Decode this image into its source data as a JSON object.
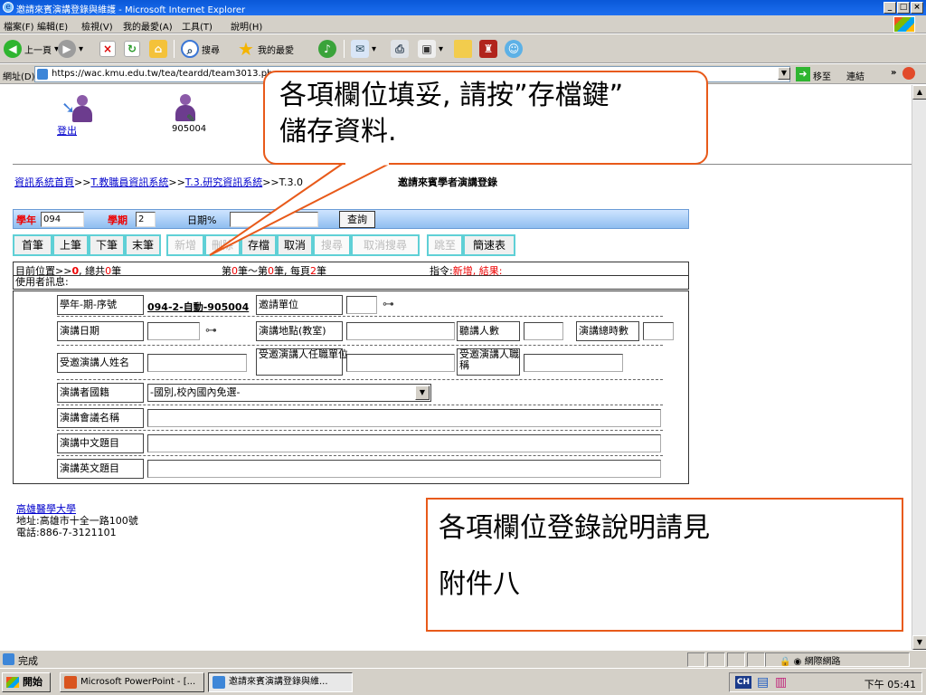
{
  "window": {
    "title": "邀請來賓演講登錄與維護 - Microsoft Internet Explorer",
    "min": "_",
    "max": "□",
    "close": "×"
  },
  "menu": [
    "檔案(F)",
    "編輯(E)",
    "檢視(V)",
    "我的最愛(A)",
    "工具(T)",
    "說明(H)"
  ],
  "toolbar": {
    "back": "上一頁",
    "search": "搜尋",
    "favorites": "我的最愛"
  },
  "address": {
    "label": "網址(D)",
    "url": "https://wac.kmu.edu.tw/tea/teardd/team3013.ph",
    "go": "移至",
    "links": "連結",
    "chevron": "»"
  },
  "header": {
    "logout": "登出",
    "user_id": "905004"
  },
  "breadcrumb": {
    "items": [
      "資訊系統首頁",
      "T.教職員資訊系統",
      "T.3.研究資訊系統"
    ],
    "sep": ">>",
    "tail": ">>T.3.0",
    "title": "邀請來賓學者演講登錄"
  },
  "query": {
    "year_label": "學年",
    "year_value": "094",
    "term_label": "學期",
    "term_value": "2",
    "date_label": "日期%",
    "date_value": "",
    "query_button": "查詢"
  },
  "actions": [
    {
      "label": "首筆",
      "enabled": true
    },
    {
      "label": "上筆",
      "enabled": true
    },
    {
      "label": "下筆",
      "enabled": true
    },
    {
      "label": "末筆",
      "enabled": true
    },
    {
      "label": "新增",
      "enabled": false
    },
    {
      "label": "刪除",
      "enabled": false
    },
    {
      "label": "存檔",
      "enabled": true
    },
    {
      "label": "取消",
      "enabled": true
    },
    {
      "label": "搜尋",
      "enabled": false
    },
    {
      "label": "取消搜尋",
      "enabled": false
    },
    {
      "label": "跳至",
      "enabled": false
    },
    {
      "label": "簡速表",
      "enabled": true
    }
  ],
  "status": {
    "pos_prefix": "目前位置>>",
    "pos_value": "0",
    "total_prefix": ", 總共",
    "total_value": "0",
    "total_suffix": "筆",
    "range_prefix": "第",
    "range_from": "0",
    "range_mid": "筆～第",
    "range_to": "0",
    "range_suffix": "筆, 每頁",
    "per_page": "2",
    "per_page_suffix": "筆",
    "cmd_label": "指令:",
    "cmd_value": "新增, 結果:",
    "user_msg": "使用者訊息:"
  },
  "form": {
    "seq_label": "學年-期-序號",
    "seq_value": "094-2-自動-905004",
    "inviter_label": "邀請單位",
    "date_label": "演講日期",
    "place_label": "演講地點(教室)",
    "audience_label": "聽講人數",
    "hours_label": "演講總時數",
    "speaker_label": "受邀演講人姓名",
    "org_label": "受邀演講人任職單位",
    "title_label": "受邀演講人職稱",
    "nation_label": "演講者國籍",
    "nation_value": "-國別,校內國內免選-",
    "conf_label": "演講會議名稱",
    "cn_title_label": "演講中文題目",
    "en_title_label": "演講英文題目"
  },
  "footer": {
    "school": "高雄醫學大學",
    "address": "地址:高雄市十全一路100號",
    "phone": "電話:886-7-3121101"
  },
  "callouts": {
    "top_line1": "各項欄位填妥, 請按”存檔鍵”",
    "top_line2": "儲存資料.",
    "bottom_line1": "各項欄位登錄說明請見",
    "bottom_line2": "附件八"
  },
  "statusbar": {
    "text": "完成",
    "zone": "網際網路"
  },
  "taskbar": {
    "start": "開始",
    "task1": "Microsoft PowerPoint - [...",
    "task2": "邀請來賓演講登錄與維...",
    "ime": "CH",
    "clock": "下午 05:41"
  },
  "colors": {
    "accent_red": "#e00000",
    "callout_border": "#e85a1a",
    "button_border": "#5fd0d6",
    "query_bar": "#8fbef0"
  }
}
